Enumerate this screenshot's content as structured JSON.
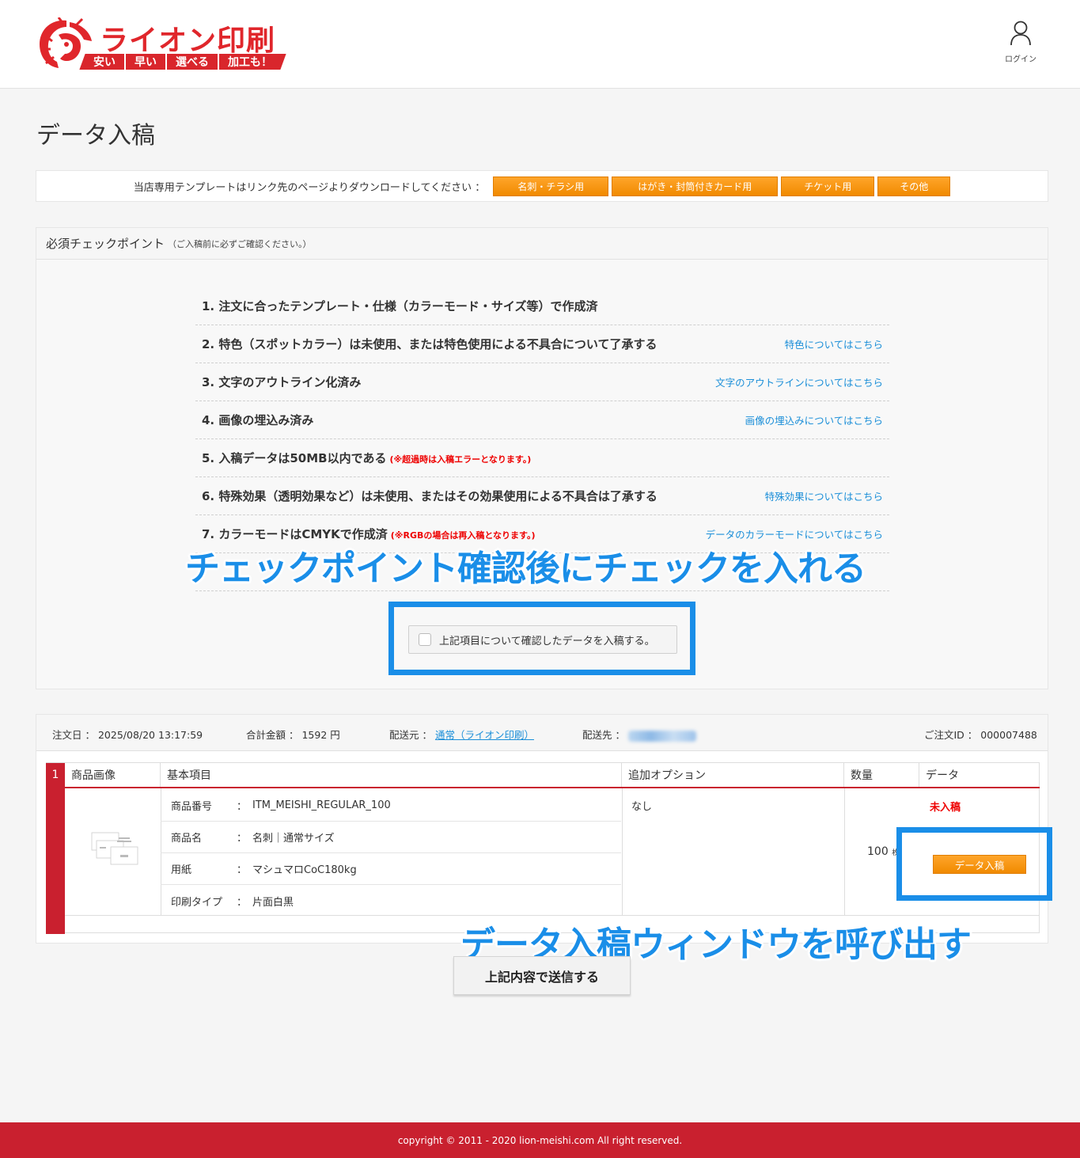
{
  "header": {
    "logo_name": "ライオン印刷",
    "logo_tagline": [
      "安い",
      "早い",
      "選べる",
      "加工も！"
    ],
    "login_label": "ログイン"
  },
  "page_title": "データ入稿",
  "template_bar": {
    "text": "当店専用テンプレートはリンク先のページよりダウンロードしてください ：",
    "buttons": [
      "名刺・チラシ用",
      "はがき・封筒付きカード用",
      "チケット用",
      "その他"
    ]
  },
  "checkpoints": {
    "title": "必須チェックポイント",
    "subtitle": "（ご入稿前に必ずご確認ください。）",
    "items": [
      {
        "text": "1. 注文に合ったテンプレート・仕様（カラーモード・サイズ等）で作成済",
        "note": "",
        "link": ""
      },
      {
        "text": "2. 特色（スポットカラー）は未使用、または特色使用による不具合について了承する",
        "note": "",
        "link": "特色についてはこちら"
      },
      {
        "text": "3. 文字のアウトライン化済み",
        "note": "",
        "link": "文字のアウトラインについてはこちら"
      },
      {
        "text": "4. 画像の埋込み済み",
        "note": "",
        "link": "画像の埋込みについてはこちら"
      },
      {
        "text": "5. 入稿データは50MB以内である",
        "note": "(※超過時は入稿エラーとなります。)",
        "link": ""
      },
      {
        "text": "6. 特殊効果（透明効果など）は未使用、またはその効果使用による不具合は了承する",
        "note": "",
        "link": "特殊効果についてはこちら"
      },
      {
        "text": "7. カラーモードはCMYKで作成済",
        "note": "(※RGBの場合は再入稿となります。)",
        "link": "データのカラーモードについてはこちら"
      },
      {
        "text": "",
        "note": "",
        "link": ""
      }
    ],
    "confirm_label": "上記項目について確認したデータを入稿する。"
  },
  "annotations": {
    "check_hint": "チェックポイント確認後にチェックを入れる",
    "upload_hint": "データ入稿ウィンドウを呼び出す"
  },
  "order": {
    "date_label": "注文日 ：",
    "date": "2025/08/20 13:17:59",
    "total_label": "合計金額 ：",
    "total": "1592 円",
    "ship_from_label": "配送元 ：",
    "ship_from": "通常（ライオン印刷）",
    "ship_to_label": "配送先 ：",
    "order_id_label": "ご注文ID ：",
    "order_id": "000007488",
    "table": {
      "row_number": "1",
      "headers": [
        "商品画像",
        "基本項目",
        "追加オプション",
        "数量",
        "データ"
      ],
      "basic": [
        {
          "key": "商品番号",
          "sep": "：",
          "value": "ITM_MEISHI_REGULAR_100"
        },
        {
          "key": "商品名",
          "sep": "：",
          "value": "名刺｜通常サイズ"
        },
        {
          "key": "用紙",
          "sep": "：",
          "value": "マシュマロCoC180kg"
        },
        {
          "key": "印刷タイプ",
          "sep": "：",
          "value": "片面白黒"
        }
      ],
      "options": "なし",
      "quantity": "100",
      "quantity_unit": "枚",
      "status": "未入稿",
      "upload_label": "データ入稿"
    }
  },
  "submit_label": "上記内容で送信する",
  "footer": "copyright © 2011 - 2020 lion-meishi.com All right reserved.",
  "colors": {
    "brand_red": "#c9202f",
    "accent_orange": "#f39800",
    "annotation_blue": "#1a8ee8",
    "link_blue": "#1a8ed8"
  }
}
